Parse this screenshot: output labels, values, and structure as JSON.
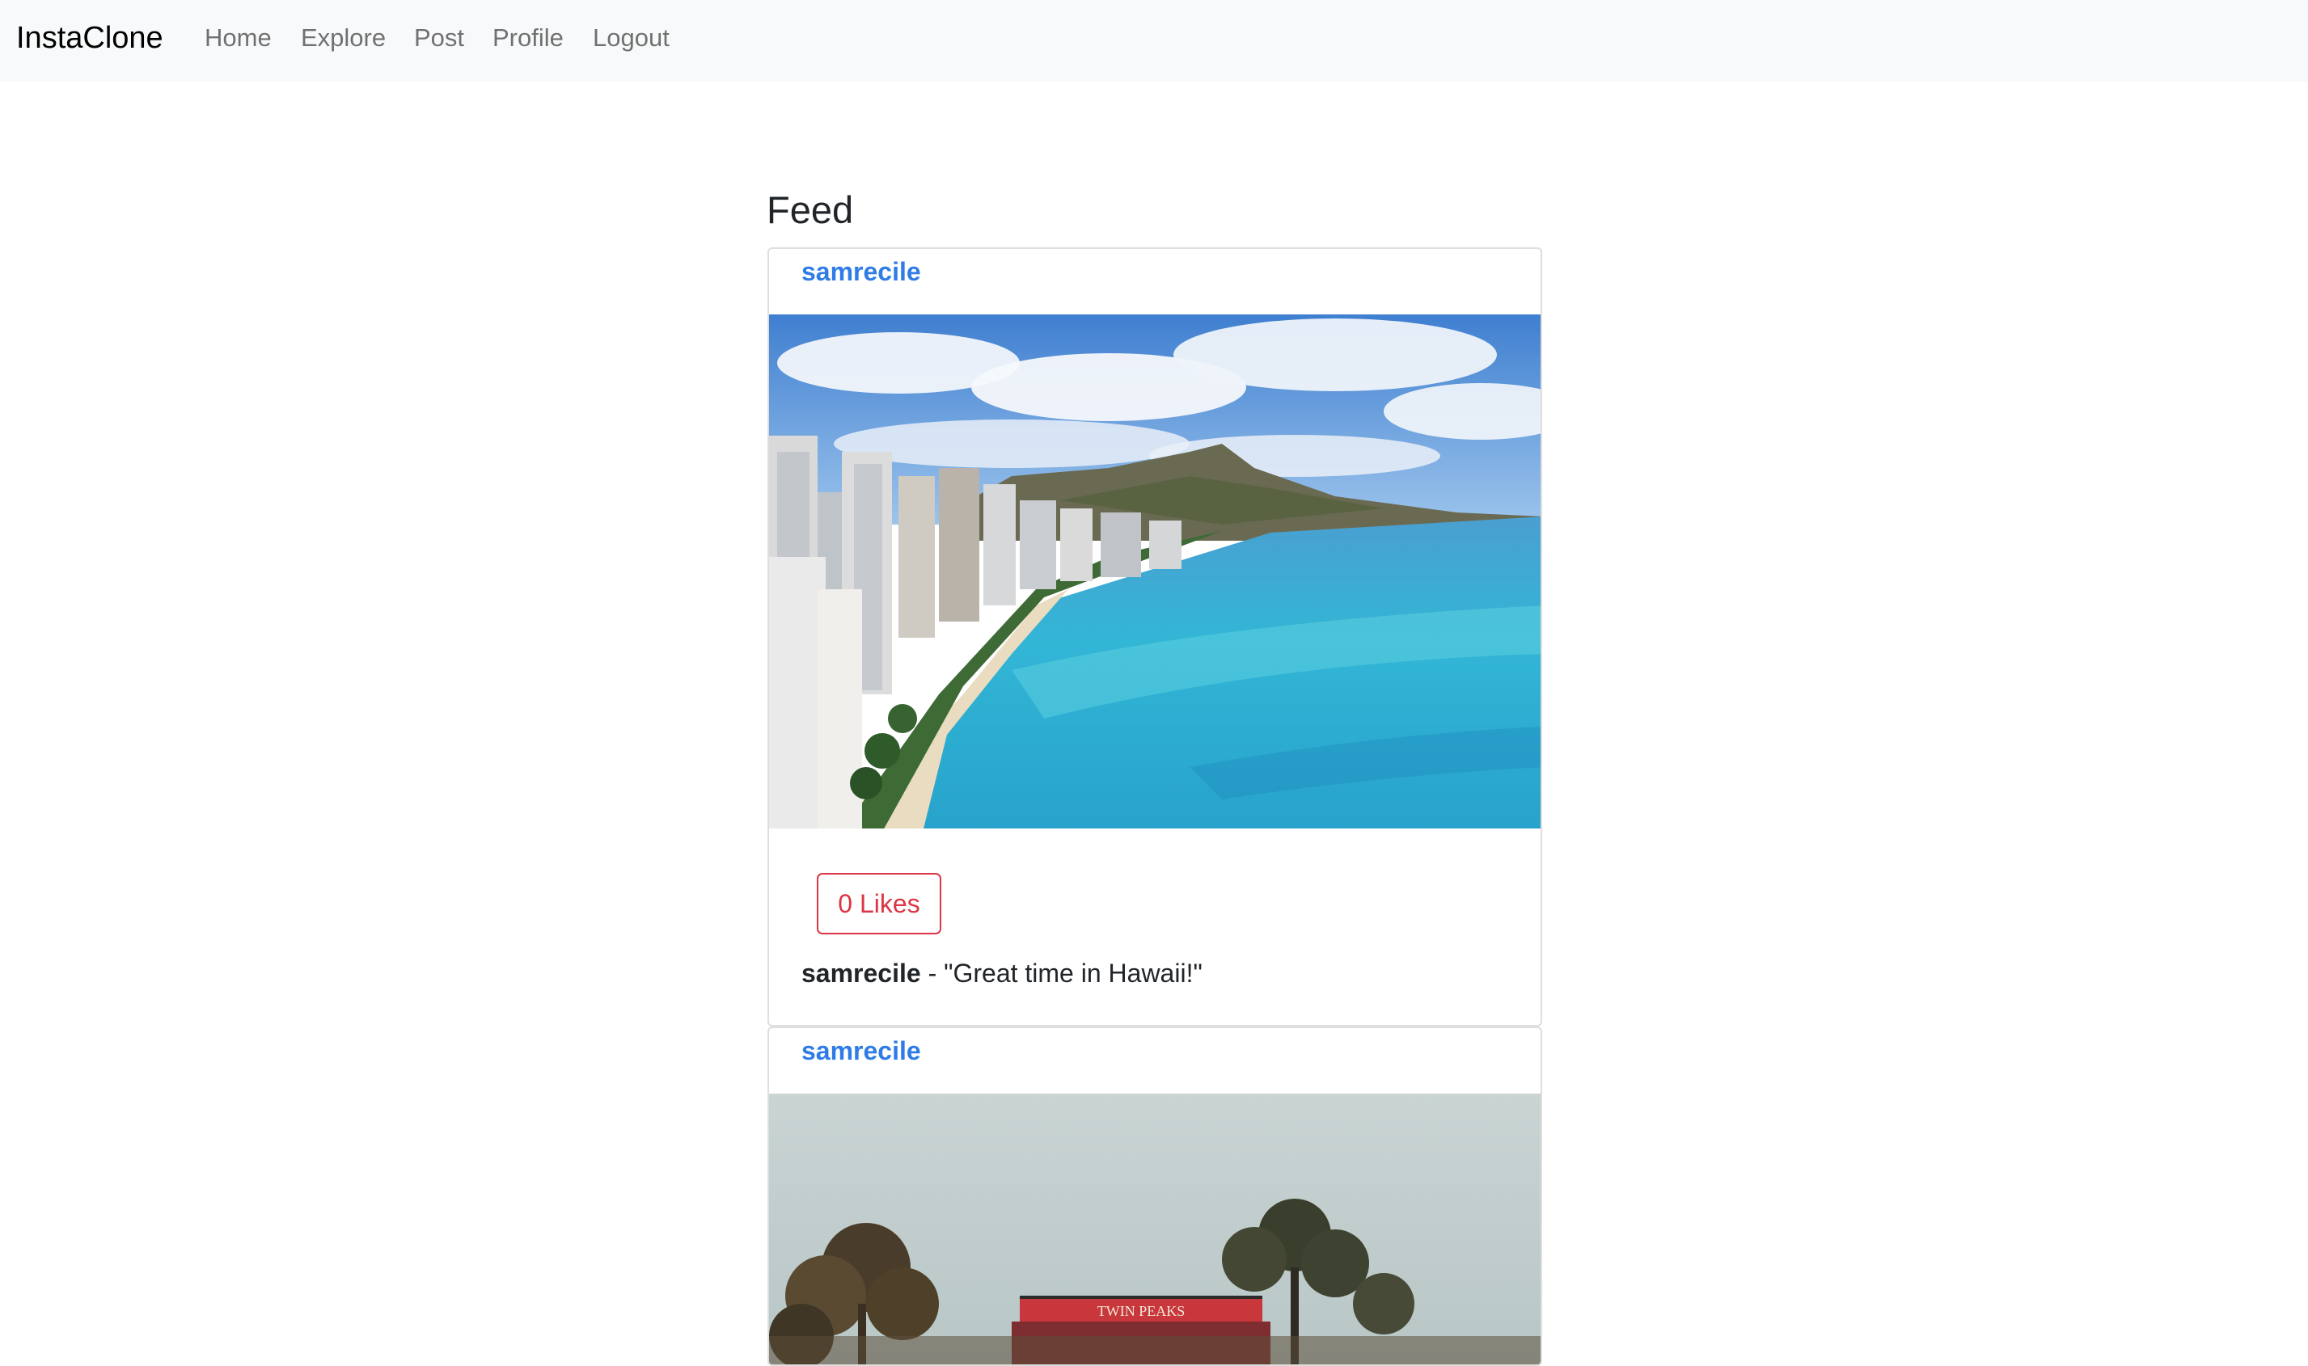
{
  "navbar": {
    "brand": "InstaClone",
    "links": [
      {
        "label": "Home"
      },
      {
        "label": "Explore"
      },
      {
        "label": "Post"
      },
      {
        "label": "Profile"
      },
      {
        "label": "Logout"
      }
    ]
  },
  "feed": {
    "title": "Feed",
    "posts": [
      {
        "username": "samrecile",
        "likes_label": "0 Likes",
        "caption_user": "samrecile",
        "caption_sep": " - ",
        "caption_text": "\"Great time in Hawaii!\""
      },
      {
        "username": "samrecile"
      }
    ]
  },
  "colors": {
    "navbar_bg": "#f8f9fa",
    "username_link": "#2f7ce6",
    "like_button": "#dc3545"
  },
  "icons": {}
}
